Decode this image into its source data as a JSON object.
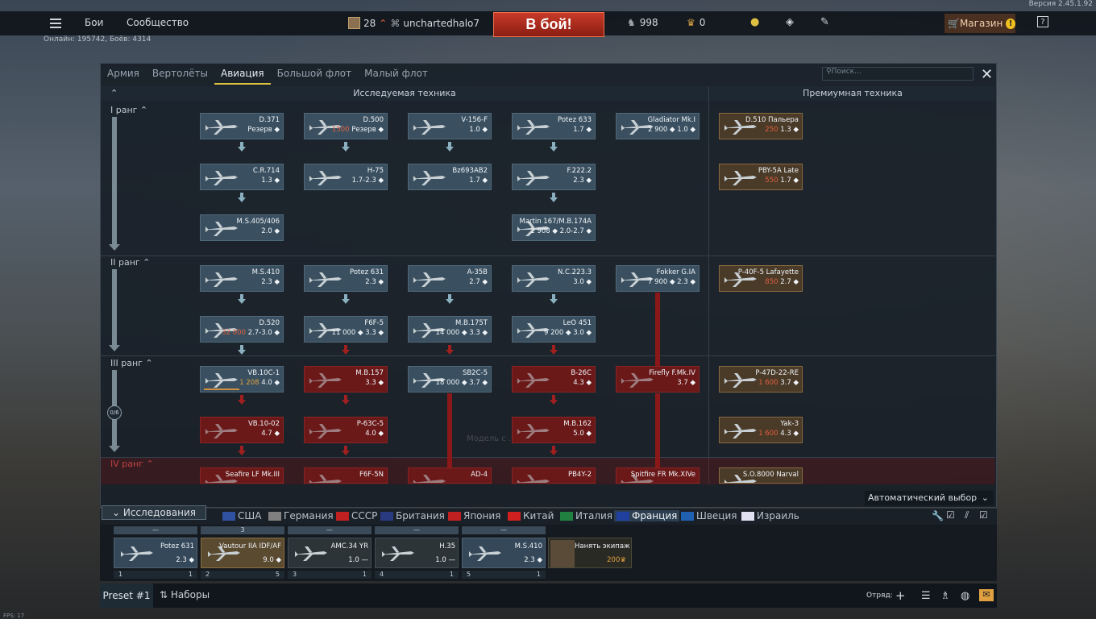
{
  "version": "Версия 2.45.1.92",
  "online": "Онлайн: 195742, Боёв: 4314",
  "fps": "FPS: 17",
  "topbar": {
    "battles": "Бои",
    "community": "Сообщество",
    "level": "28",
    "username": "unchartedhalo7",
    "to_battle": "В бой!",
    "silver_lions": "998",
    "golden_eagles": "0",
    "shop": "Магазин"
  },
  "tabs": [
    "Армия",
    "Вертолёты",
    "Авиация",
    "Большой флот",
    "Малый флот"
  ],
  "search_placeholder": "Поиск...",
  "headers": {
    "research": "Исследуемая техника",
    "premium": "Премиумная техника"
  },
  "ranks": [
    {
      "label": "I ранг"
    },
    {
      "label": "II ранг"
    },
    {
      "label": "III ранг",
      "progress": "0/6"
    },
    {
      "label": "IV ранг"
    }
  ],
  "vehicles": {
    "r1c1a": {
      "name": "D.371",
      "meta": "Резерв ◆"
    },
    "r1c1b": {
      "name": "C.R.714",
      "meta": "1.3 ◆"
    },
    "r1c1c": {
      "name": "M.S.405/406",
      "meta": "2.0 ◆"
    },
    "r1c2a": {
      "name": "D.500",
      "price": "1500",
      "meta": "Резерв ◆"
    },
    "r1c2b": {
      "name": "H-75",
      "meta": "1.7-2.3 ◆"
    },
    "r1c3a": {
      "name": "V-156-F",
      "meta": "1.0 ◆"
    },
    "r1c3b": {
      "name": "Bz693AB2",
      "meta": "1.7 ◆"
    },
    "r1c4a": {
      "name": "Potez 633",
      "meta": "1.7 ◆"
    },
    "r1c4b": {
      "name": "F.222.2",
      "meta": "2.3 ◆"
    },
    "r1c4c": {
      "name": "Martin 167/M.B.174A",
      "meta": "2 908 ◆ 2.0-2.7 ◆"
    },
    "r1c5a": {
      "name": "Gladiator Mk.I",
      "meta": "2 900 ◆ 1.0 ◆"
    },
    "r1p1": {
      "name": "D.510 Пальера",
      "price": "250",
      "meta": "1.3 ◆"
    },
    "r1p2": {
      "name": "PBY-5A Late",
      "price": "550",
      "meta": "1.7 ◆"
    },
    "r2c1a": {
      "name": "M.S.410",
      "meta": "2.3 ◆"
    },
    "r2c1b": {
      "name": "D.520",
      "price": "32 000",
      "meta": "2.7-3.0 ◆"
    },
    "r2c2a": {
      "name": "Potez 631",
      "meta": "2.3 ◆"
    },
    "r2c2b": {
      "name": "F6F-5",
      "meta": "11 000 ◆ 3.3 ◆"
    },
    "r2c3a": {
      "name": "A-35B",
      "meta": "2.7 ◆"
    },
    "r2c3b": {
      "name": "M.B.175T",
      "meta": "14 000 ◆ 3.3 ◆"
    },
    "r2c4a": {
      "name": "N.C.223.3",
      "meta": "3.0 ◆"
    },
    "r2c4b": {
      "name": "LeO 451",
      "meta": "9 200 ◆ 3.0 ◆"
    },
    "r2c5a": {
      "name": "Fokker G.IA",
      "meta": "7 900 ◆ 2.3 ◆"
    },
    "r2p1": {
      "name": "P-40F-5 Lafayette",
      "price": "850",
      "meta": "2.7 ◆"
    },
    "r3c1a": {
      "name": "VB.10C-1",
      "rp": "1 208",
      "meta": "4.0 ◆"
    },
    "r3c1b": {
      "name": "VB.10-02",
      "meta": "4.7 ◆"
    },
    "r3c2a": {
      "name": "M.B.157",
      "meta": "3.3 ◆"
    },
    "r3c2b": {
      "name": "P-63C-5",
      "meta": "4.0 ◆"
    },
    "r3c3a": {
      "name": "SB2C-5",
      "meta": "18 000 ◆ 3.7 ◆"
    },
    "r3c4a": {
      "name": "B-26C",
      "meta": "4.3 ◆"
    },
    "r3c4b": {
      "name": "M.B.162",
      "meta": "5.0 ◆"
    },
    "r3c5a": {
      "name": "Firefly F.Mk.IV",
      "meta": "3.7 ◆"
    },
    "r3p1": {
      "name": "P-47D-22-RE",
      "price": "1 600",
      "meta": "3.7 ◆"
    },
    "r3p2": {
      "name": "Yak-3",
      "price": "1 600",
      "meta": "4.3 ◆"
    },
    "r4c1": {
      "name": "Seafire LF Mk.III"
    },
    "r4c2": {
      "name": "F6F-5N"
    },
    "r4c3": {
      "name": "AD-4"
    },
    "r4c4": {
      "name": "PB4Y-2"
    },
    "r4c5": {
      "name": "Spitfire FR Mk.XIVe"
    },
    "r4p1": {
      "name": "S.O.8000 Narval"
    }
  },
  "overlay_text": "Модель с ... турами.",
  "auto_select": "Автоматический выбор",
  "research_tab": "Исследования",
  "nations": [
    "США",
    "Германия",
    "СССР",
    "Британия",
    "Япония",
    "Китай",
    "Италия",
    "Франция",
    "Швеция",
    "Израиль"
  ],
  "active_nation": "Франция",
  "slots": [
    {
      "top": "—",
      "name": "Potez 631",
      "br": "2.3 ◆",
      "left": "1",
      "right": "1"
    },
    {
      "top": "3",
      "name": "Vautour IIA IDF/AF",
      "br": "9.0 ◆",
      "left": "2",
      "right": "5"
    },
    {
      "top": "—",
      "name": "AMC.34 YR",
      "br": "1.0 —",
      "left": "3",
      "right": "1"
    },
    {
      "top": "—",
      "name": "H.35",
      "br": "1.0 —",
      "left": "4",
      "right": "1"
    },
    {
      "top": "—",
      "name": "M.S.410",
      "br": "2.3 ◆",
      "left": "5",
      "right": "1"
    }
  ],
  "hire_crew": {
    "label": "Нанять экипаж",
    "price": "200"
  },
  "preset": "Preset #1",
  "sets": "Наборы",
  "squad": "Отряд:",
  "colors": {
    "accent": "#e0c040",
    "locked": "#6a1818",
    "premium": "#4a3a28",
    "battle": "#c83a28"
  }
}
